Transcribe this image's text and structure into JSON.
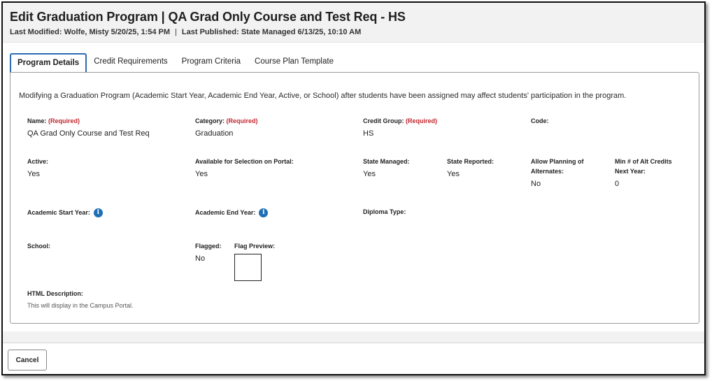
{
  "header": {
    "title": "Edit Graduation Program | QA Grad Only Course and Test Req - HS",
    "last_modified": "Last Modified: Wolfe, Misty 5/20/25, 1:54 PM",
    "separator": "|",
    "last_published": "Last Published: State Managed 6/13/25, 10:10 AM"
  },
  "tabs": [
    {
      "label": "Program Details",
      "active": true
    },
    {
      "label": "Credit Requirements",
      "active": false
    },
    {
      "label": "Program Criteria",
      "active": false
    },
    {
      "label": "Course Plan Template",
      "active": false
    }
  ],
  "notice": "Modifying a Graduation Program (Academic Start Year, Academic End Year, Active, or School) after students have been assigned may affect students' participation in the program.",
  "required_marker": "(Required)",
  "fields": {
    "name": {
      "label": "Name:",
      "value": "QA Grad Only Course and Test Req"
    },
    "category": {
      "label": "Category:",
      "value": "Graduation"
    },
    "credit_group": {
      "label": "Credit Group:",
      "value": "HS"
    },
    "code": {
      "label": "Code:",
      "value": ""
    },
    "active": {
      "label": "Active:",
      "value": "Yes"
    },
    "portal": {
      "label": "Available for Selection on Portal:",
      "value": "Yes"
    },
    "state_managed": {
      "label": "State Managed:",
      "value": "Yes"
    },
    "state_reported": {
      "label": "State Reported:",
      "value": "Yes"
    },
    "allow_planning": {
      "label_line1": "Allow Planning of",
      "label_line2": "Alternates:",
      "value": "No"
    },
    "min_alt_credits": {
      "label_line1": "Min # of Alt Credits",
      "label_line2": "Next Year:",
      "value": "0"
    },
    "start_year": {
      "label": "Academic Start Year:"
    },
    "end_year": {
      "label": "Academic End Year:"
    },
    "diploma_type": {
      "label": "Diploma Type:"
    },
    "school": {
      "label": "School:"
    },
    "flagged": {
      "label": "Flagged:",
      "value": "No"
    },
    "flag_preview": {
      "label": "Flag Preview:"
    },
    "html_description": {
      "label": "HTML Description:",
      "help": "This will display in the Campus Portal."
    }
  },
  "icons": {
    "info": "info-icon",
    "info_glyph": "i",
    "info_color": "#1f6fb5"
  },
  "colors": {
    "required": "#c0262d",
    "active_tab_border": "#2b6cb0"
  },
  "footer": {
    "cancel_label": "Cancel"
  }
}
